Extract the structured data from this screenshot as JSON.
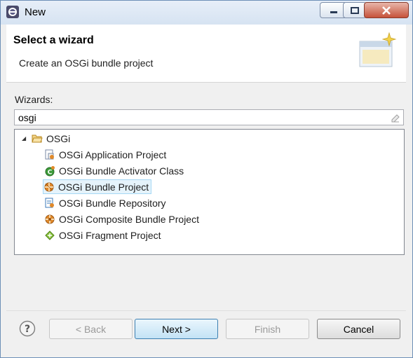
{
  "window": {
    "title": "New"
  },
  "header": {
    "title": "Select a wizard",
    "description": "Create an OSGi bundle project"
  },
  "wizards": {
    "label": "Wizards:",
    "filter_value": "osgi",
    "tree": {
      "folder": "OSGi",
      "items": [
        {
          "label": "OSGi Application Project",
          "icon": "osgi-application-project-icon"
        },
        {
          "label": "OSGi Bundle Activator Class",
          "icon": "activator-class-icon"
        },
        {
          "label": "OSGi Bundle Project",
          "icon": "osgi-bundle-project-icon",
          "selected": true
        },
        {
          "label": "OSGi Bundle Repository",
          "icon": "osgi-bundle-repository-icon"
        },
        {
          "label": "OSGi Composite Bundle Project",
          "icon": "osgi-composite-bundle-icon"
        },
        {
          "label": "OSGi Fragment Project",
          "icon": "osgi-fragment-project-icon"
        }
      ]
    }
  },
  "buttons": {
    "back": "< Back",
    "next": "Next >",
    "finish": "Finish",
    "cancel": "Cancel"
  },
  "colors": {
    "accent": "#3c7fb1",
    "selection": "#e5f3fb",
    "close_button": "#c6523a"
  }
}
